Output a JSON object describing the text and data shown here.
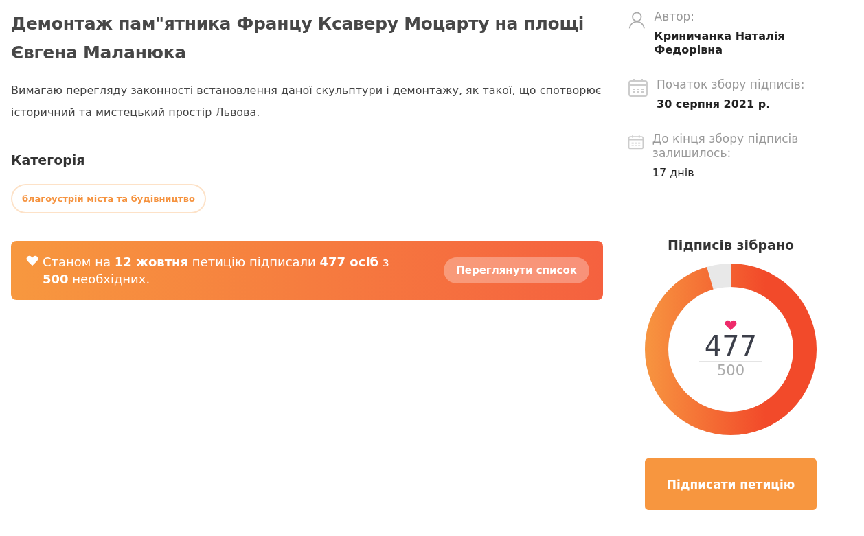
{
  "petition": {
    "title": "Демонтаж пам\"ятника Францу Ксаверу Моцарту на площі Євгена Маланюка",
    "description": "Вимагаю перегляду законності встановлення даної скульптури і демонтажу, як такої, що спотворює історичний та мистецький простір Львова.",
    "category_heading": "Категорія",
    "categories": [
      "благоустрій міста та будівництво"
    ],
    "status": {
      "text": "Станом на **12 жовтня** петицію підписали **477 осіб** з **500** необхідних.",
      "button": "Переглянути список"
    }
  },
  "meta": [
    {
      "kind": "person",
      "label": "Автор:",
      "value": "Криничанка Наталія Федорівна",
      "bold": true
    },
    {
      "kind": "calendar",
      "label": "Початок збору підписів:",
      "value": "30 серпня 2021 р.",
      "bold": true
    },
    {
      "kind": "calendar",
      "label": "До кінця збору підписів залишилось:",
      "value": "17 днів",
      "bold": false
    }
  ],
  "progress": {
    "title": "Підписів зібрано",
    "count": "477",
    "goal": "500",
    "level": 0.954
  },
  "sign_button": "Підписати петицію"
}
